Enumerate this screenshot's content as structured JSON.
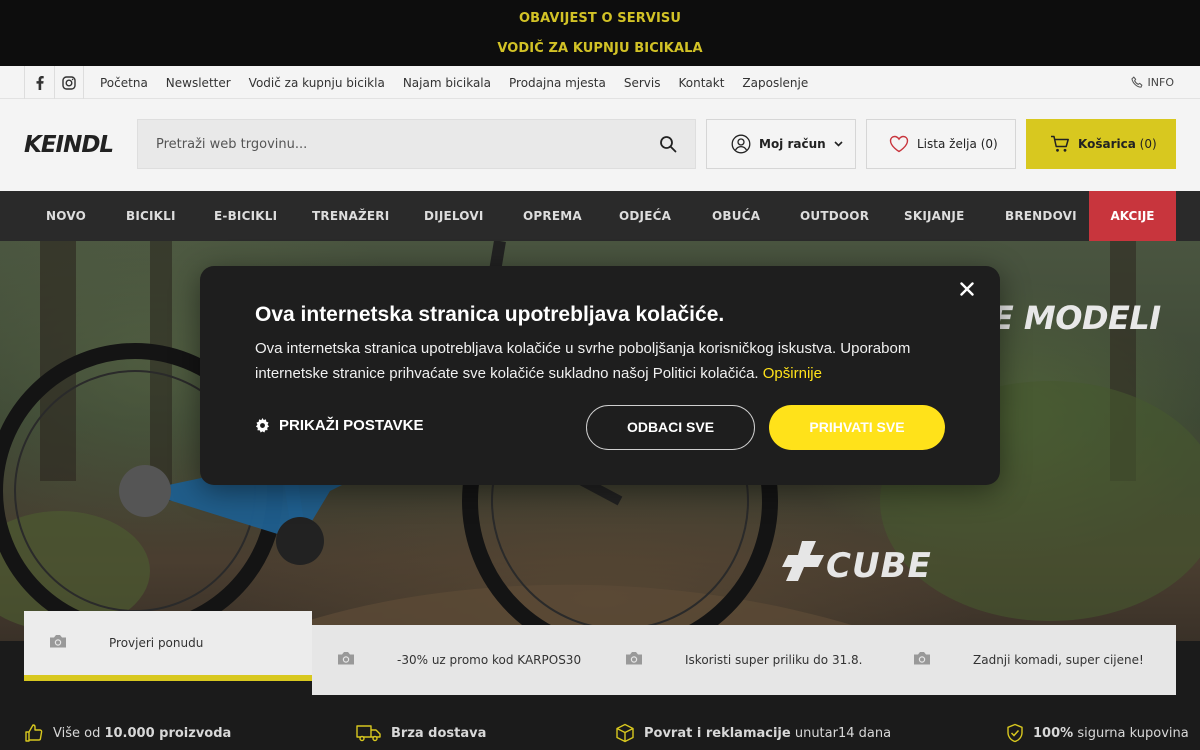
{
  "announcement": {
    "line1": "OBAVIJEST O SERVISU",
    "line2": "VODIČ ZA KUPNJU BICIKALA",
    "color": "#d2c226"
  },
  "utility": {
    "social": [
      "facebook-icon",
      "instagram-icon"
    ],
    "links": [
      "Početna",
      "Newsletter",
      "Vodič za kupnju bicikla",
      "Najam bicikala",
      "Prodajna mjesta",
      "Servis",
      "Kontakt",
      "Zaposlenje"
    ],
    "info_label": "INFO"
  },
  "header": {
    "logo_text": "KEINDL",
    "search_placeholder": "Pretraži web trgovinu...",
    "account_label": "Moj račun",
    "wishlist_label": "Lista želja",
    "wishlist_count": "(0)",
    "cart_label": "Košarica",
    "cart_count": "(0)",
    "cart_color": "#d8c81f"
  },
  "nav": {
    "items": [
      "NOVO",
      "BICIKLI",
      "E-BICIKLI",
      "TRENAŽERI",
      "DIJELOVI",
      "OPREMA",
      "ODJEĆA",
      "OBUĆA",
      "OUTDOOR",
      "SKIJANJE",
      "BRENDOVI"
    ],
    "sale_label": "AKCIJE",
    "sale_color": "#c8353d"
  },
  "hero": {
    "headline": "BE MODELI",
    "brand": "CUBE"
  },
  "tabs": [
    {
      "label": "Provjeri ponudu",
      "active": true
    },
    {
      "label": "-30% uz promo kod KARPOS30",
      "active": false
    },
    {
      "label": "Iskoristi super priliku do 31.8.",
      "active": false
    },
    {
      "label": "Zadnji komadi, super cijene!",
      "active": false
    }
  ],
  "benefits": {
    "b1_prefix": "Više od",
    "b1_bold": "10.000 proizvoda",
    "b2_bold": "Brza dostava",
    "b3_bold": "Povrat i reklamacije",
    "b3_suffix": "unutar14 dana",
    "b4_bold": "100%",
    "b4_suffix": "sigurna kupovina"
  },
  "cookie": {
    "title": "Ova internetska stranica upotrebljava kolačiće.",
    "body": "Ova internetska stranica upotrebljava kolačiće u svrhe poboljšanja korisničkog iskustva. Uporabom internetske stranice prihvaćate sve kolačiće sukladno našoj Politici kolačića.",
    "more_link": "Opširnije",
    "settings_label": "PRIKAŽI POSTAVKE",
    "reject_label": "ODBACI SVE",
    "accept_label": "PRIHVATI SVE",
    "accent_color": "#ffe21a"
  }
}
